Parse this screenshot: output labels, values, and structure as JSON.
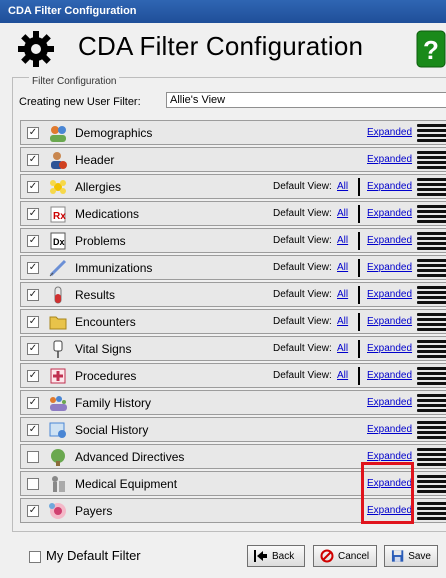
{
  "window": {
    "title": "CDA Filter Configuration"
  },
  "header": {
    "title": "CDA Filter Configuration",
    "gear_icon": "gear-icon",
    "help_icon": "help-icon",
    "help_glyph": "?"
  },
  "filter": {
    "legend": "Filter Configuration",
    "creating_label": "Creating new User Filter:",
    "name_value": "Allie's View"
  },
  "sections": [
    {
      "label": "Demographics",
      "checked": true,
      "icon": "people-icon",
      "default_view": false,
      "expanded": "Expanded"
    },
    {
      "label": "Header",
      "checked": true,
      "icon": "person-icon",
      "default_view": false,
      "expanded": "Expanded"
    },
    {
      "label": "Allergies",
      "checked": true,
      "icon": "allergy-icon",
      "default_view": true,
      "default_label": "Default View:",
      "all": "All",
      "expanded": "Expanded"
    },
    {
      "label": "Medications",
      "checked": true,
      "icon": "rx-icon",
      "default_view": true,
      "default_label": "Default View:",
      "all": "All",
      "expanded": "Expanded"
    },
    {
      "label": "Problems",
      "checked": true,
      "icon": "dx-icon",
      "default_view": true,
      "default_label": "Default View:",
      "all": "All",
      "expanded": "Expanded"
    },
    {
      "label": "Immunizations",
      "checked": true,
      "icon": "syringe-icon",
      "default_view": true,
      "default_label": "Default View:",
      "all": "All",
      "expanded": "Expanded"
    },
    {
      "label": "Results",
      "checked": true,
      "icon": "test-tube-icon",
      "default_view": true,
      "default_label": "Default View:",
      "all": "All",
      "expanded": "Expanded"
    },
    {
      "label": "Encounters",
      "checked": true,
      "icon": "folder-icon",
      "default_view": true,
      "default_label": "Default View:",
      "all": "All",
      "expanded": "Expanded"
    },
    {
      "label": "Vital Signs",
      "checked": true,
      "icon": "iv-bag-icon",
      "default_view": true,
      "default_label": "Default View:",
      "all": "All",
      "expanded": "Expanded"
    },
    {
      "label": "Procedures",
      "checked": true,
      "icon": "procedure-icon",
      "default_view": true,
      "default_label": "Default View:",
      "all": "All",
      "expanded": "Expanded"
    },
    {
      "label": "Family History",
      "checked": true,
      "icon": "family-icon",
      "default_view": false,
      "expanded": "Expanded"
    },
    {
      "label": "Social History",
      "checked": true,
      "icon": "social-icon",
      "default_view": false,
      "expanded": "Expanded"
    },
    {
      "label": "Advanced Directives",
      "checked": false,
      "icon": "directive-icon",
      "default_view": false,
      "expanded": "Expanded"
    },
    {
      "label": "Medical Equipment",
      "checked": false,
      "icon": "equipment-icon",
      "default_view": false,
      "expanded": "Expanded"
    },
    {
      "label": "Payers",
      "checked": true,
      "icon": "payer-icon",
      "default_view": false,
      "expanded": "Expanded"
    }
  ],
  "footer": {
    "default_filter_label": "My Default Filter",
    "default_filter_checked": false,
    "back_label": "Back",
    "cancel_label": "Cancel",
    "save_label": "Save"
  },
  "colors": {
    "title_bar": "#2f66b3",
    "link": "#0000cc",
    "highlight": "#e0141d",
    "help_green": "#1a8a1a"
  }
}
